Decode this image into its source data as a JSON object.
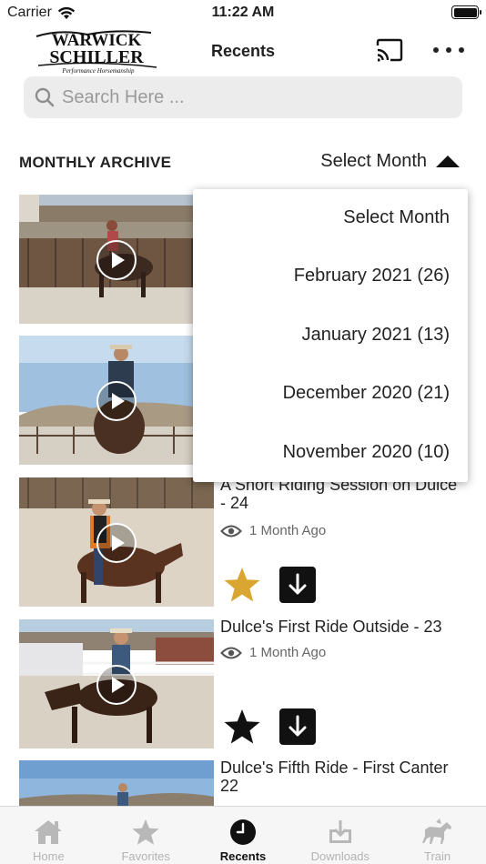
{
  "status_bar": {
    "carrier": "Carrier",
    "time": "11:22 AM"
  },
  "header": {
    "title": "Recents",
    "logo_text": "Warwick Schiller Performance Horsemanship"
  },
  "search": {
    "placeholder": "Search Here ..."
  },
  "archive": {
    "label": "MONTHLY ARCHIVE",
    "select_label": "Select Month"
  },
  "dropdown": {
    "options": [
      "Select Month",
      "February 2021 (26)",
      "January 2021 (13)",
      "December 2020 (21)",
      "November 2020 (10)"
    ]
  },
  "videos": [
    {
      "title": "",
      "meta": "",
      "favorited": false
    },
    {
      "title": "",
      "meta": "",
      "favorited": false
    },
    {
      "title": "A Short Riding Session on Dulce - 24",
      "meta": "1 Month Ago",
      "favorited": true
    },
    {
      "title": "Dulce's First Ride Outside - 23",
      "meta": "1 Month Ago",
      "favorited": false
    },
    {
      "title": "Dulce's Fifth Ride - First Canter 22",
      "meta": "",
      "favorited": false
    }
  ],
  "tabs": [
    {
      "label": "Home",
      "icon": "home-icon",
      "active": false
    },
    {
      "label": "Favorites",
      "icon": "star-icon",
      "active": false
    },
    {
      "label": "Recents",
      "icon": "clock-icon",
      "active": true
    },
    {
      "label": "Downloads",
      "icon": "download-icon",
      "active": false
    },
    {
      "label": "Train",
      "icon": "horse-icon",
      "active": false
    }
  ],
  "colors": {
    "favorite_gold": "#d8a631",
    "accent_dark": "#111111",
    "tab_inactive": "#b3b3b3"
  }
}
